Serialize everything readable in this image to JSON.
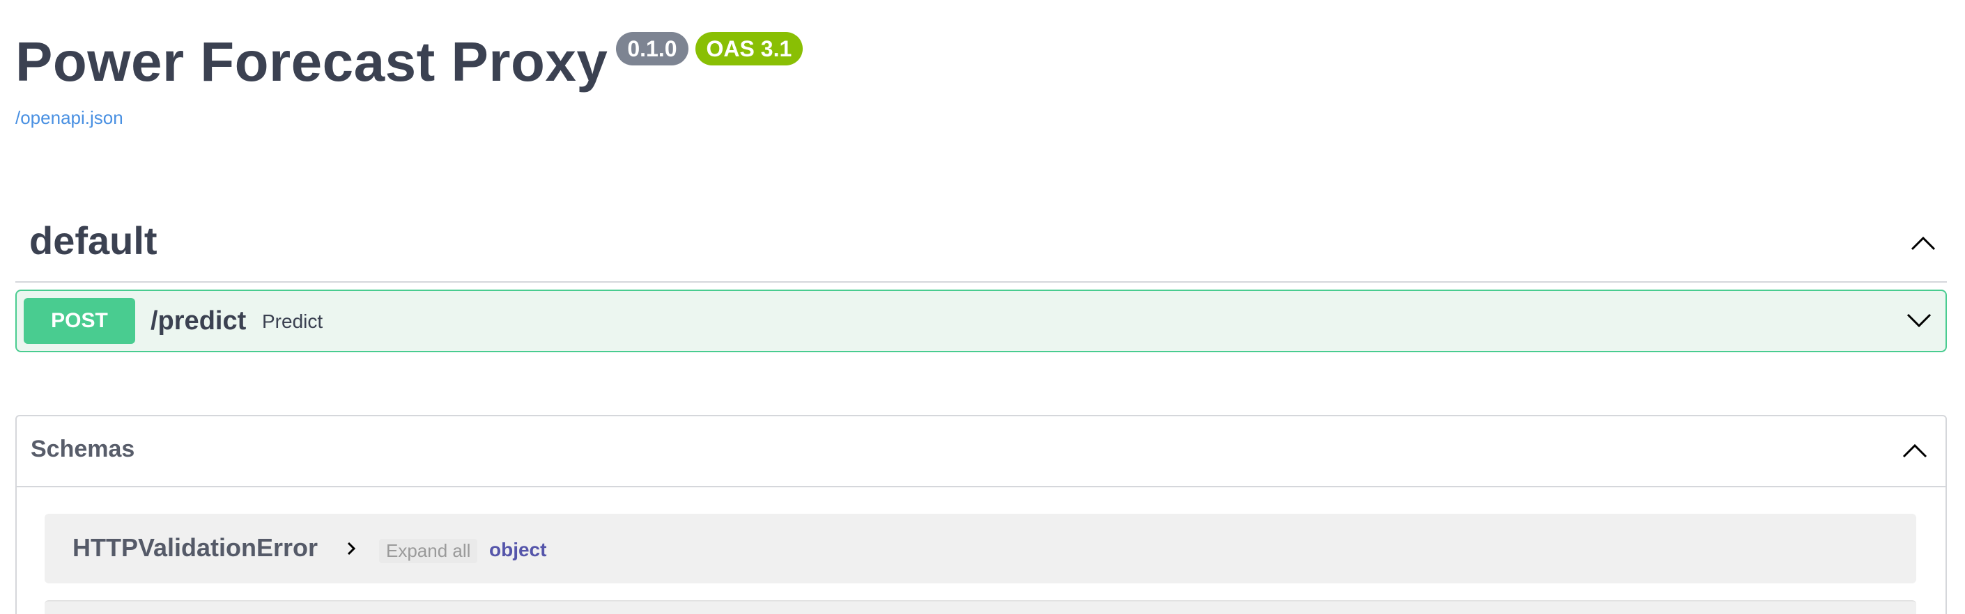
{
  "info": {
    "title": "Power Forecast Proxy",
    "version_badge": "0.1.0",
    "oas_badge": "OAS 3.1",
    "spec_link": "/openapi.json"
  },
  "colors": {
    "post": "#49cc90",
    "post_bg": "#ecf6f0",
    "link": "#4990e2",
    "version_badge": "#7d8492",
    "oas_badge": "#89bf04",
    "schema_type": "#5555aa"
  },
  "tag": {
    "name": "default",
    "toggle_icon": "chevron-up-icon"
  },
  "operation": {
    "method": "POST",
    "path": "/predict",
    "summary": "Predict",
    "toggle_icon": "chevron-down-icon"
  },
  "schemas": {
    "title": "Schemas",
    "toggle_icon": "chevron-up-icon",
    "models": [
      {
        "name": "HTTPValidationError",
        "expand_label": "Expand all",
        "type": "object"
      }
    ]
  }
}
